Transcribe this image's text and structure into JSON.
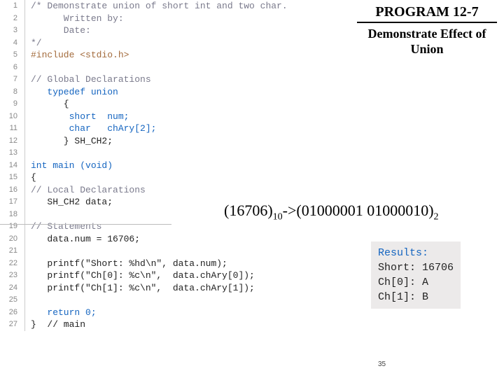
{
  "heading": "PROGRAM 12-7",
  "subheading": "Demonstrate Effect of Union",
  "formula": {
    "left_num": "(16706)",
    "left_base": "10",
    "arrow": "->",
    "right_num": "(01000001 01000010)",
    "right_base": "2"
  },
  "results": {
    "title": "Results:",
    "lines": [
      "Short: 16706",
      "Ch[0]: A",
      "Ch[1]: B"
    ]
  },
  "page_number": "35",
  "gutter": [
    "1",
    "2",
    "3",
    "4",
    "5",
    "6",
    "7",
    "8",
    "9",
    "10",
    "11",
    "12",
    "13",
    "14",
    "15",
    "16",
    "17",
    "18",
    "19",
    "20",
    "21",
    "22",
    "23",
    "24",
    "25",
    "26",
    "27"
  ],
  "code_lines": [
    {
      "cls": "cmt",
      "text": "/* Demonstrate union of short int and two char."
    },
    {
      "cls": "cmt",
      "text": "      Written by:"
    },
    {
      "cls": "cmt",
      "text": "      Date:"
    },
    {
      "cls": "cmt",
      "text": "*/"
    },
    {
      "cls": "pre",
      "text": "#include <stdio.h>"
    },
    {
      "cls": "plain",
      "text": ""
    },
    {
      "cls": "cmt",
      "text": "// Global Declarations"
    },
    {
      "cls": "kw",
      "text": "   typedef union"
    },
    {
      "cls": "plain",
      "text": "      {"
    },
    {
      "cls": "kw",
      "text": "       short  num;"
    },
    {
      "cls": "kw",
      "text": "       char   chAry[2];"
    },
    {
      "cls": "plain",
      "text": "      } SH_CH2;"
    },
    {
      "cls": "plain",
      "text": ""
    },
    {
      "cls": "kw",
      "text": "int main (void)"
    },
    {
      "cls": "plain",
      "text": "{"
    },
    {
      "cls": "cmt",
      "text": "// Local Declarations"
    },
    {
      "cls": "plain",
      "text": "   SH_CH2 data;"
    },
    {
      "cls": "plain",
      "text": ""
    },
    {
      "cls": "cmt",
      "text": "// Statements"
    },
    {
      "cls": "plain",
      "text": "   data.num = 16706;"
    },
    {
      "cls": "plain",
      "text": ""
    },
    {
      "cls": "plain",
      "text": "   printf(\"Short: %hd\\n\", data.num);"
    },
    {
      "cls": "plain",
      "text": "   printf(\"Ch[0]: %c\\n\",  data.chAry[0]);"
    },
    {
      "cls": "plain",
      "text": "   printf(\"Ch[1]: %c\\n\",  data.chAry[1]);"
    },
    {
      "cls": "plain",
      "text": ""
    },
    {
      "cls": "kw",
      "text": "   return 0;"
    },
    {
      "cls": "plain",
      "text": "}  // main"
    }
  ]
}
